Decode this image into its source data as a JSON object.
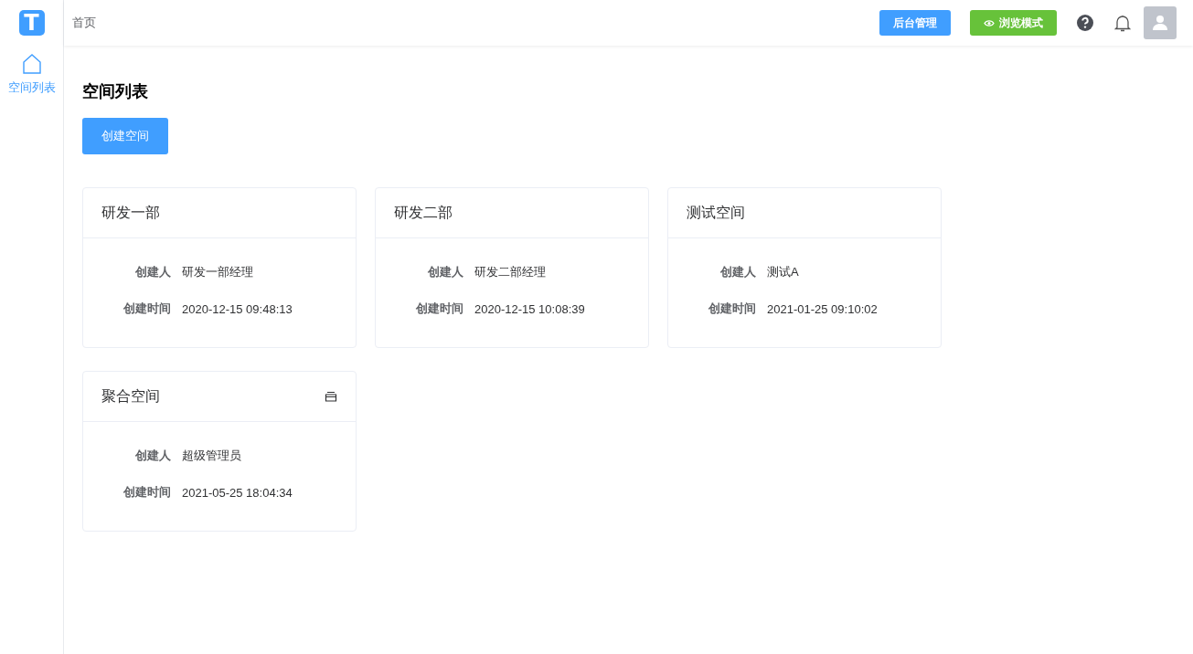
{
  "logo": "T",
  "sidebar": {
    "items": [
      {
        "label": "空间列表",
        "selected": true
      }
    ]
  },
  "header": {
    "breadcrumb": "首页",
    "admin_button": "后台管理",
    "browse_button": "浏览模式"
  },
  "page": {
    "title": "空间列表",
    "create_button": "创建空间"
  },
  "cards": [
    {
      "title": "研发一部",
      "aggregated": false,
      "fields": [
        {
          "label": "创建人",
          "value": "研发一部经理"
        },
        {
          "label": "创建时间",
          "value": "2020-12-15 09:48:13"
        }
      ]
    },
    {
      "title": "研发二部",
      "aggregated": false,
      "fields": [
        {
          "label": "创建人",
          "value": "研发二部经理"
        },
        {
          "label": "创建时间",
          "value": "2020-12-15 10:08:39"
        }
      ]
    },
    {
      "title": "测试空间",
      "aggregated": false,
      "fields": [
        {
          "label": "创建人",
          "value": "测试A"
        },
        {
          "label": "创建时间",
          "value": "2021-01-25 09:10:02"
        }
      ]
    },
    {
      "title": "聚合空间",
      "aggregated": true,
      "fields": [
        {
          "label": "创建人",
          "value": "超级管理员"
        },
        {
          "label": "创建时间",
          "value": "2021-05-25 18:04:34"
        }
      ]
    }
  ]
}
